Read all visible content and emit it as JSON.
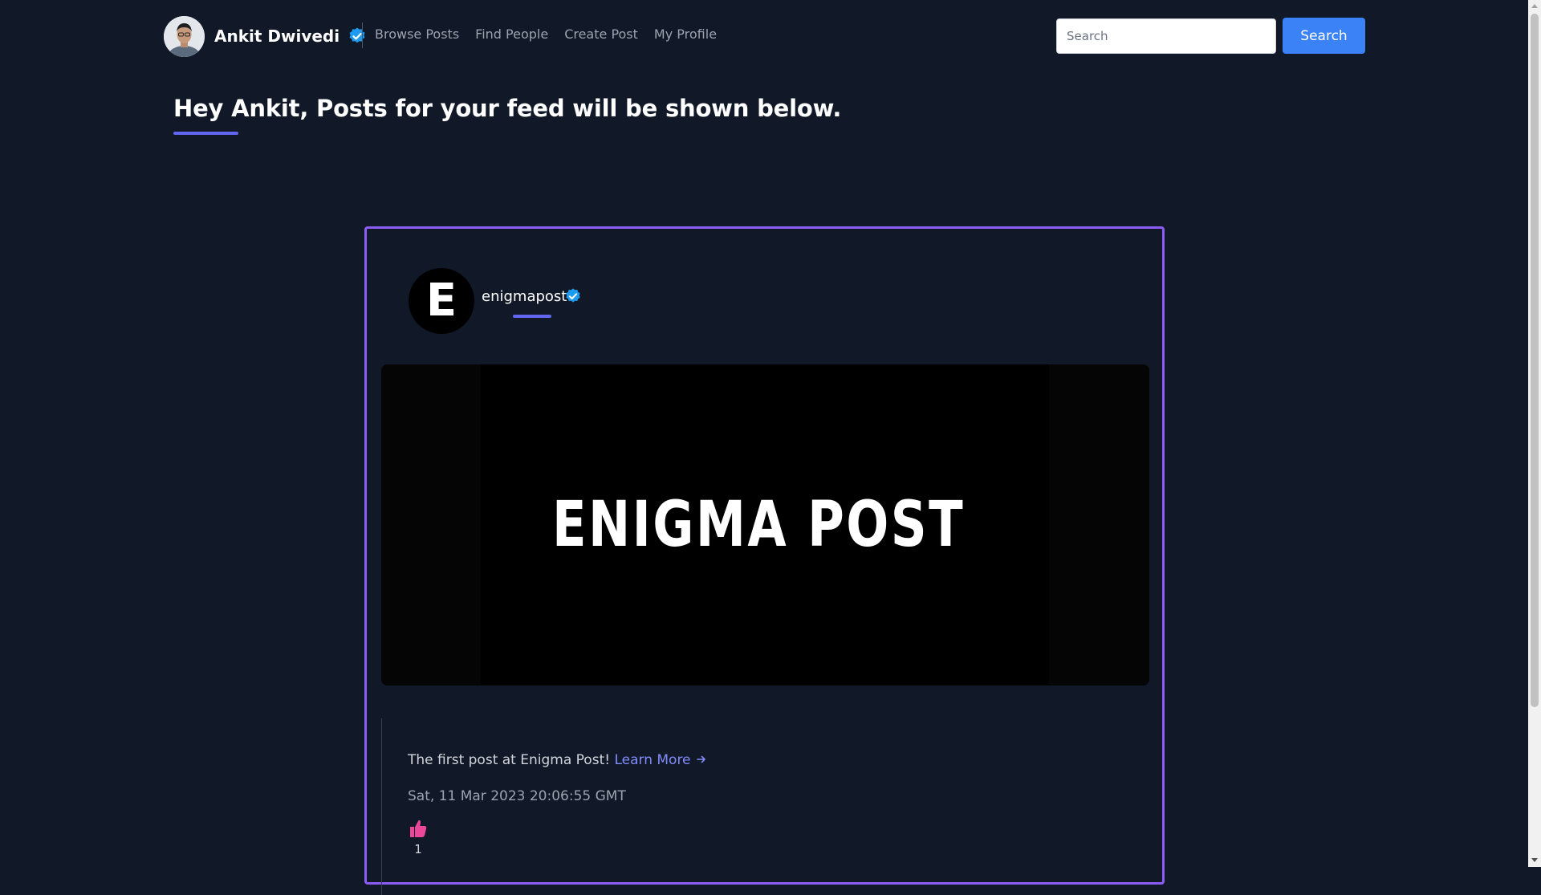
{
  "header": {
    "user_name": "Ankit Dwivedi",
    "nav": [
      {
        "label": "Browse Posts"
      },
      {
        "label": "Find People"
      },
      {
        "label": "Create Post"
      },
      {
        "label": "My Profile"
      }
    ],
    "search_placeholder": "Search",
    "search_button_label": "Search"
  },
  "page": {
    "title": "Hey Ankit, Posts for your feed will be shown below."
  },
  "post": {
    "avatar_letter": "E",
    "username": "enigmapost",
    "image_text": "ENIGMA POST",
    "text": "The first post at Enigma Post!",
    "link_label": "Learn More",
    "date": "Sat, 11 Mar 2023 20:06:55 GMT",
    "likes": "1"
  },
  "colors": {
    "background": "#111827",
    "accent_border": "#8b5cf6",
    "underline": "#6366f1",
    "search_button": "#3b82f6",
    "verified_badge": "#1d9bf0",
    "like_icon": "#ec4899",
    "link": "#818cf8"
  },
  "icons": {
    "verified": "verified-badge-icon",
    "arrow": "arrow-right-icon",
    "like": "thumbs-up-icon"
  }
}
